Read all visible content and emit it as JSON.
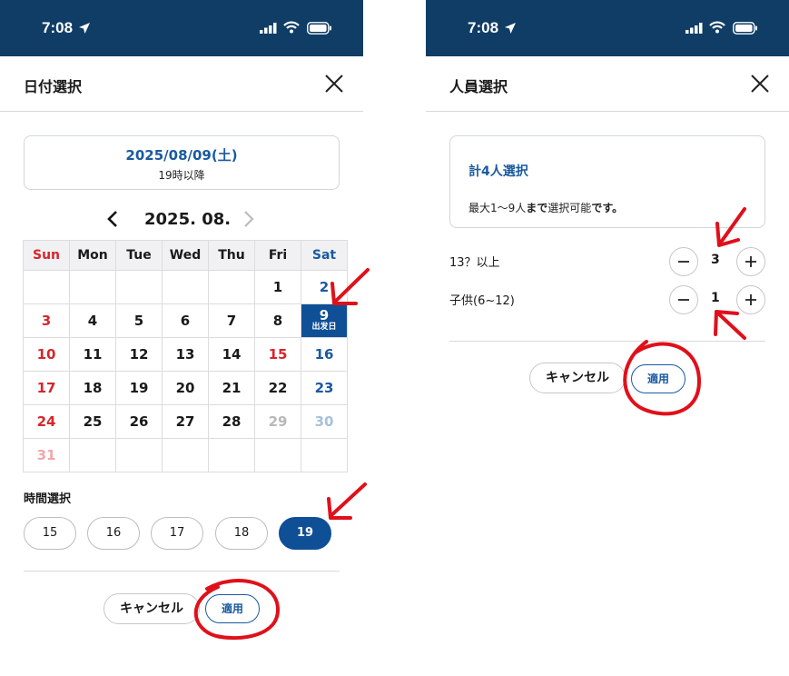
{
  "status_bar": {
    "time": "7:08"
  },
  "date_screen": {
    "title": "日付選択",
    "selected_date": "2025/08/09(土)",
    "selected_time_note": "19時以降",
    "month_label": "2025. 08.",
    "weekdays": [
      "Sun",
      "Mon",
      "Tue",
      "Wed",
      "Thu",
      "Fri",
      "Sat"
    ],
    "weeks": [
      [
        "",
        "",
        "",
        "",
        "",
        "1",
        "2"
      ],
      [
        "3",
        "4",
        "5",
        "6",
        "7",
        "8",
        "9"
      ],
      [
        "10",
        "11",
        "12",
        "13",
        "14",
        "15",
        "16"
      ],
      [
        "17",
        "18",
        "19",
        "20",
        "21",
        "22",
        "23"
      ],
      [
        "24",
        "25",
        "26",
        "27",
        "28",
        "29",
        "30"
      ],
      [
        "31",
        "",
        "",
        "",
        "",
        "",
        ""
      ]
    ],
    "selected_day": "9",
    "selected_day_caption": "出发日",
    "time_label": "時間選択",
    "times": [
      "15",
      "16",
      "17",
      "18",
      "19"
    ],
    "active_time": "19",
    "cancel_label": "キャンセル",
    "apply_label": "適用"
  },
  "people_screen": {
    "title": "人員選択",
    "total_label": "計4人選択",
    "note_pre": "最大1〜9人",
    "note_bold1": "まで",
    "note_mid": "選択可能",
    "note_bold2": "です。",
    "rows": [
      {
        "label": "13？以上",
        "value": "3"
      },
      {
        "label": "子供(6~12)",
        "value": "1"
      }
    ],
    "cancel_label": "キャンセル",
    "apply_label": "適用"
  },
  "colors": {
    "header_bg": "#0f3d66",
    "accent": "#1a5aa0",
    "selected_bg": "#0f4f96",
    "sunday_red": "#d6262c",
    "annotation_red": "#e0101a"
  }
}
